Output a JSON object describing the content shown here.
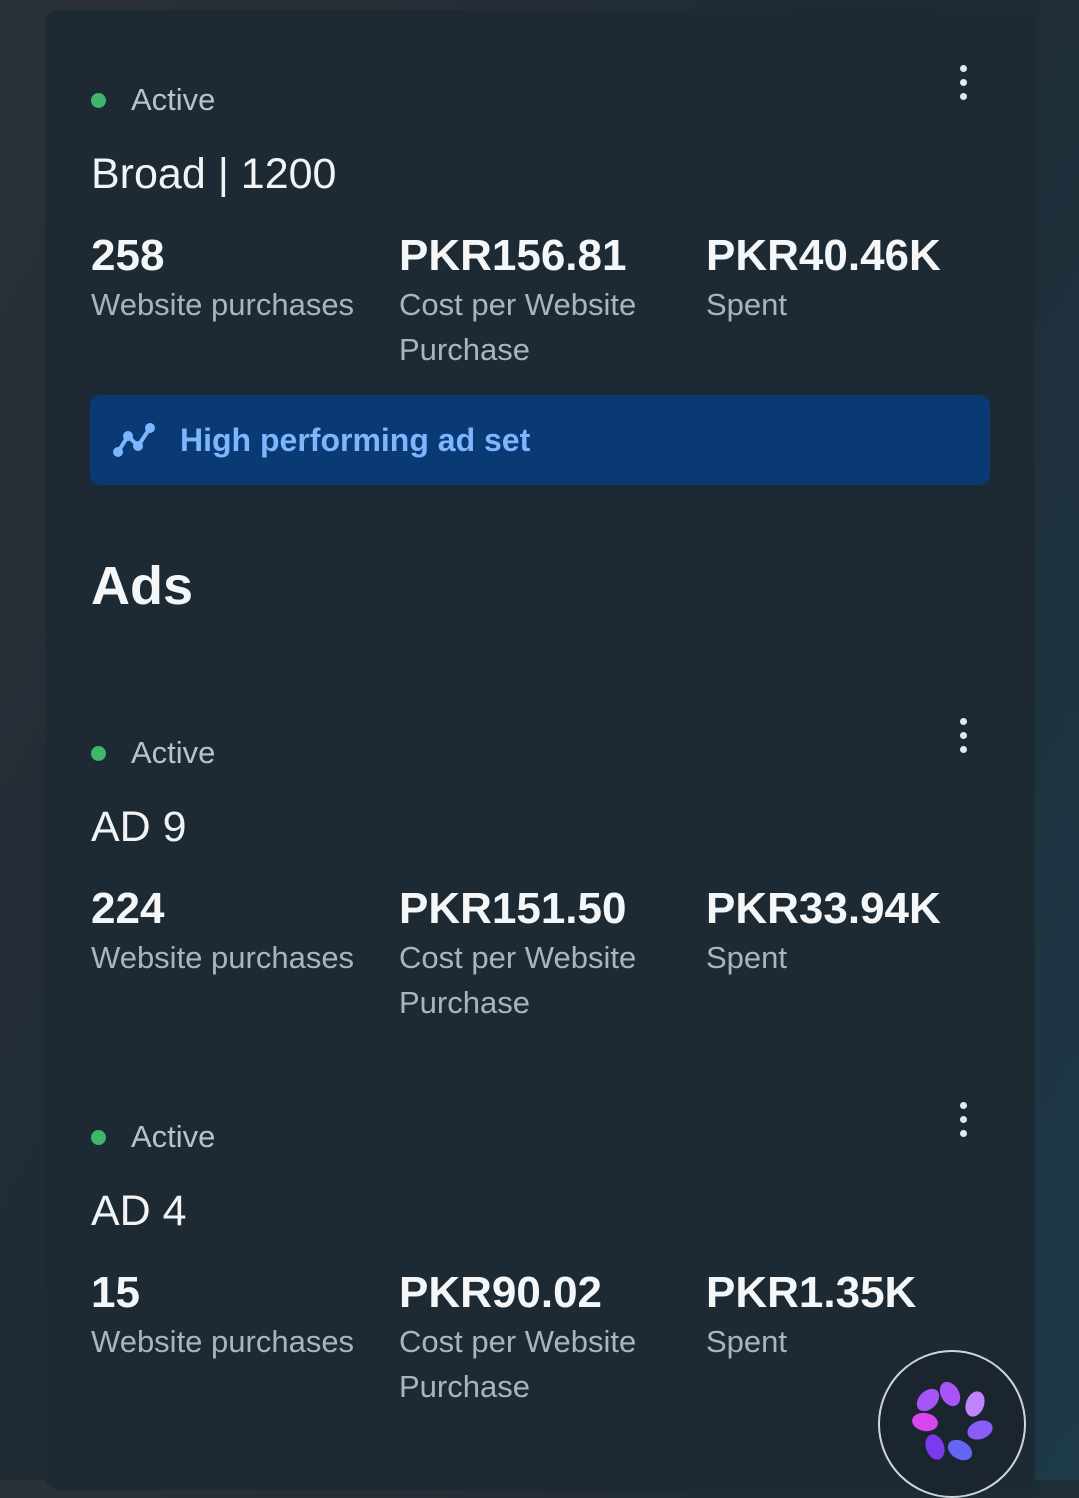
{
  "adset": {
    "status": "Active",
    "name": "Broad | 1200",
    "metrics": [
      {
        "value": "258",
        "label": "Website purchases"
      },
      {
        "value": "PKR156.81",
        "label": "Cost per Website Purchase"
      },
      {
        "value": "PKR40.46K",
        "label": "Spent"
      }
    ],
    "badge": {
      "label": "High performing ad set",
      "icon": "trend-chart-icon"
    }
  },
  "ads_heading": "Ads",
  "ads": [
    {
      "status": "Active",
      "name": "AD 9",
      "metrics": [
        {
          "value": "224",
          "label": "Website purchases"
        },
        {
          "value": "PKR151.50",
          "label": "Cost per Website Purchase"
        },
        {
          "value": "PKR33.94K",
          "label": "Spent"
        }
      ]
    },
    {
      "status": "Active",
      "name": "AD 4",
      "metrics": [
        {
          "value": "15",
          "label": "Website purchases"
        },
        {
          "value": "PKR90.02",
          "label": "Cost per Website Purchase"
        },
        {
          "value": "PKR1.35K",
          "label": "Spent"
        }
      ]
    }
  ],
  "colors": {
    "active_dot": "#3fb76a",
    "badge_bg": "#0a3a73",
    "badge_text": "#7cb6ff",
    "panel_bg": "#1e2a33"
  },
  "icons": {
    "more": "more-vertical-icon",
    "assistant": "ai-assistant-icon"
  }
}
